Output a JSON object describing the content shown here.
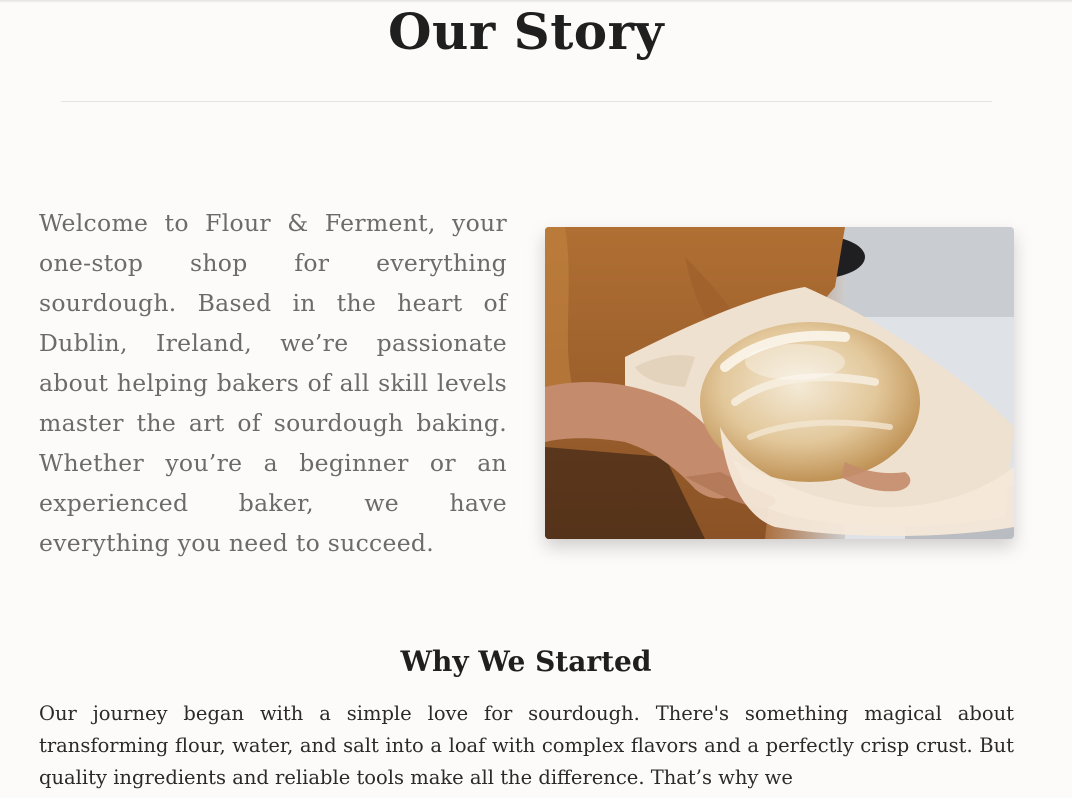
{
  "page": {
    "title": "Our Story"
  },
  "intro": {
    "text": "Welcome to Flour & Ferment, your one-stop shop for everything sourdough. Based in the heart of Dublin, Ireland, we’re passionate about helping bakers of all skill levels master the art of sourdough baking. Whether you’re a beginner or an experienced baker, we have everything you need to succeed.",
    "image_subject": "hands-holding-sourdough-loaf"
  },
  "why_section": {
    "heading": "Why We Started",
    "text": "Our journey began with a simple love for sourdough. There's something magical about transforming flour, water, and salt into a loaf with complex flavors and a perfectly crisp crust. But quality ingredients and reliable tools make all the difference. That’s why we"
  },
  "colors": {
    "background": "#fdfbf9",
    "heading": "#1f1f1f",
    "intro_text": "#6b6b6b",
    "body_text": "#2a2a2a",
    "divider": "#e6e3df"
  }
}
